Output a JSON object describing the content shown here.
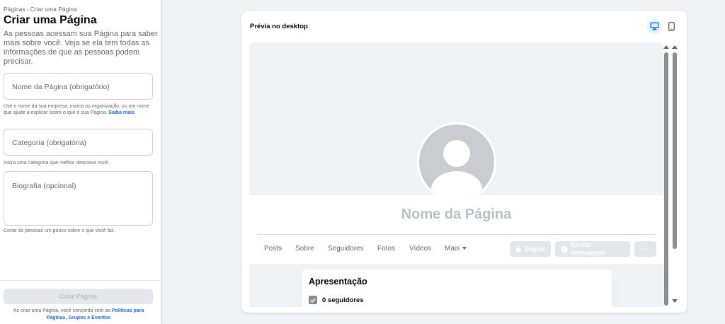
{
  "sidebar": {
    "breadcrumb_root": "Páginas",
    "breadcrumb_sep": "›",
    "breadcrumb_current": "Criar uma Página",
    "title": "Criar uma Página",
    "intro": "As pessoas acessam sua Página para saber mais sobre você. Veja se ela tem todas as informações de que as pessoas podem precisar.",
    "name_field": {
      "placeholder": "Nome da Página (obrigatório)",
      "help": "Use o nome da sua empresa, marca ou organização, ou um nome que ajude a explicar sobre o que é sua Página.",
      "help_link": "Saiba mais"
    },
    "category_field": {
      "placeholder": "Categoria (obrigatória)",
      "help": "Insira uma categoria que melhor descreva você."
    },
    "bio_field": {
      "placeholder": "Biografia (opcional)",
      "help": "Conte às pessoas um pouco sobre o que você faz."
    },
    "create_button": "Criar Página",
    "terms_text": "Ao criar uma Página, você concorda com as",
    "terms_link": "Políticas para Páginas, Grupos e Eventos"
  },
  "preview": {
    "title": "Prévia no desktop",
    "desktop_icon": "desktop-icon",
    "mobile_icon": "mobile-icon",
    "page_name": "Nome da Página",
    "tabs": [
      "Posts",
      "Sobre",
      "Seguidores",
      "Fotos",
      "Vídeos",
      "Mais"
    ],
    "follow_button": "Seguir",
    "message_button": "Enviar mensagem",
    "more_button": "···",
    "intro_title": "Apresentação",
    "followers": "0 seguidores"
  },
  "colors": {
    "accent": "#216fdb",
    "background": "#f0f2f5",
    "disabled": "#e4e6eb"
  }
}
